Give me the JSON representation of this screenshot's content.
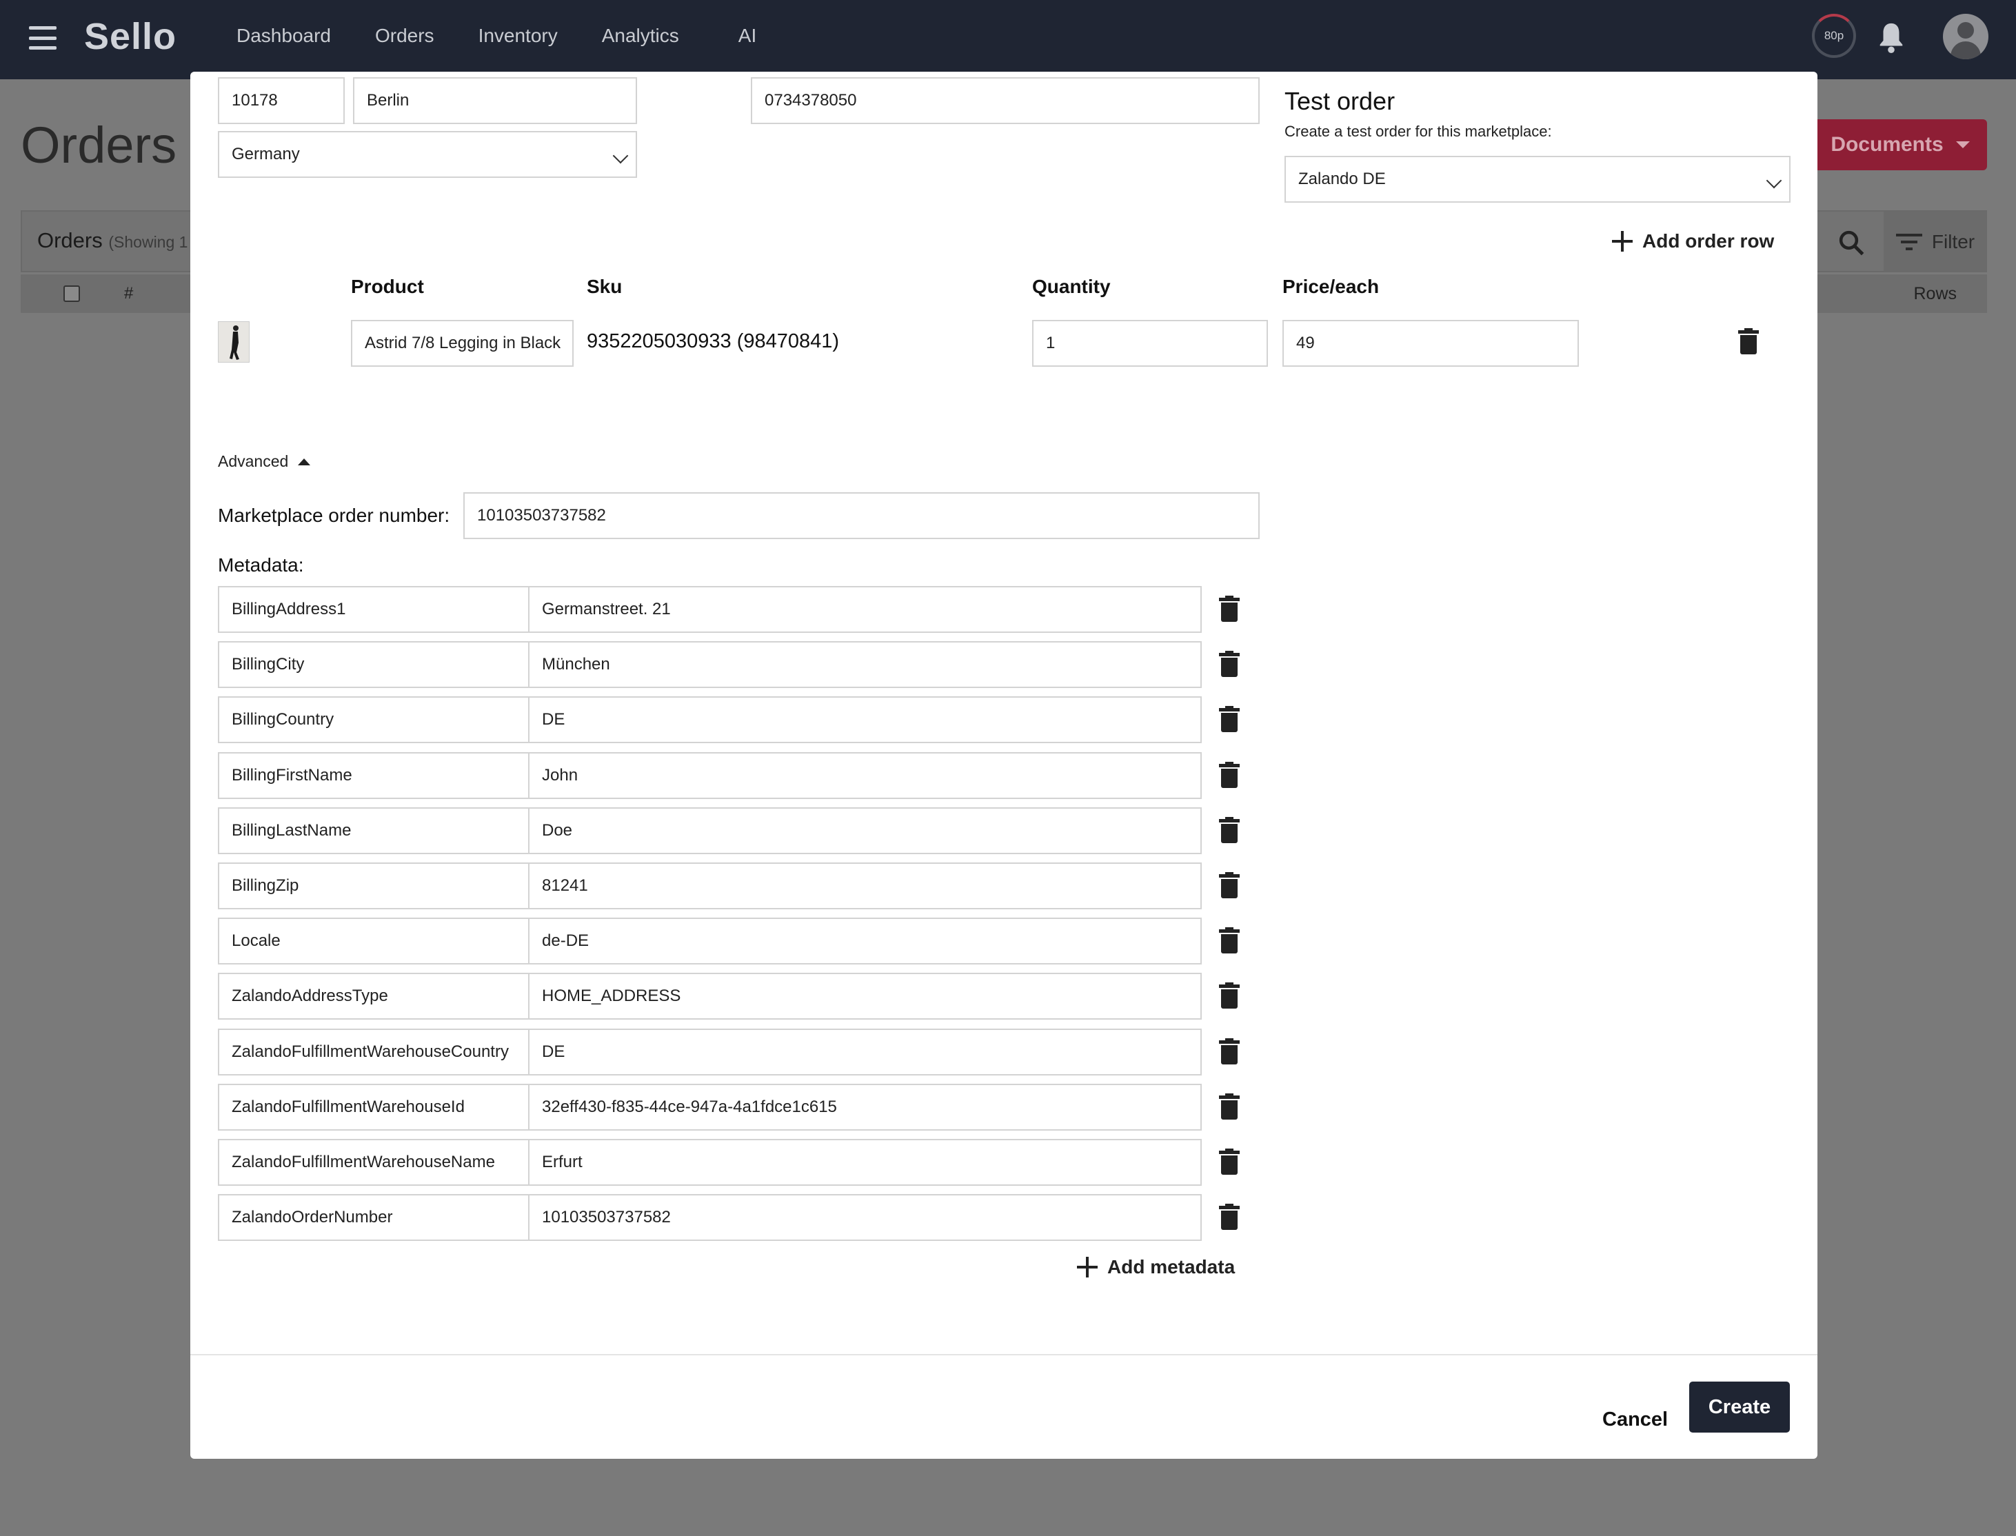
{
  "app": {
    "logo": "Sello",
    "nav": [
      "Dashboard",
      "Orders",
      "Inventory",
      "Analytics",
      "AI"
    ],
    "timer_label": "80p"
  },
  "page": {
    "title": "Orders",
    "documents_button": "Documents",
    "orders_bar_title": "Orders",
    "orders_bar_sub": "(Showing 1",
    "table_hash": "#",
    "table_rows": "Rows"
  },
  "modal": {
    "address": {
      "zip": "10178",
      "city": "Berlin",
      "phone": "0734378050",
      "country": "Germany"
    },
    "test_order": {
      "title": "Test order",
      "subtitle": "Create a test order for this marketplace:",
      "marketplace": "Zalando DE"
    },
    "add_order_row": "Add order row",
    "columns": {
      "product": "Product",
      "sku": "Sku",
      "quantity": "Quantity",
      "price": "Price/each"
    },
    "row": {
      "product": "Astrid 7/8 Legging in Black",
      "sku": "9352205030933 (98470841)",
      "quantity": "1",
      "price": "49"
    },
    "advanced_label": "Advanced",
    "marketplace_order_label": "Marketplace order number:",
    "marketplace_order_number": "10103503737582",
    "metadata_label": "Metadata:",
    "metadata": [
      {
        "key": "BillingAddress1",
        "value": "Germanstreet. 21"
      },
      {
        "key": "BillingCity",
        "value": "München"
      },
      {
        "key": "BillingCountry",
        "value": "DE"
      },
      {
        "key": "BillingFirstName",
        "value": "John"
      },
      {
        "key": "BillingLastName",
        "value": "Doe"
      },
      {
        "key": "BillingZip",
        "value": "81241"
      },
      {
        "key": "Locale",
        "value": "de-DE"
      },
      {
        "key": "ZalandoAddressType",
        "value": "HOME_ADDRESS"
      },
      {
        "key": "ZalandoFulfillmentWarehouseCountry",
        "value": "DE"
      },
      {
        "key": "ZalandoFulfillmentWarehouseId",
        "value": "32eff430-f835-44ce-947a-4a1fdce1c615"
      },
      {
        "key": "ZalandoFulfillmentWarehouseName",
        "value": "Erfurt"
      },
      {
        "key": "ZalandoOrderNumber",
        "value": "10103503737582"
      }
    ],
    "add_metadata": "Add metadata",
    "cancel": "Cancel",
    "create": "Create"
  }
}
